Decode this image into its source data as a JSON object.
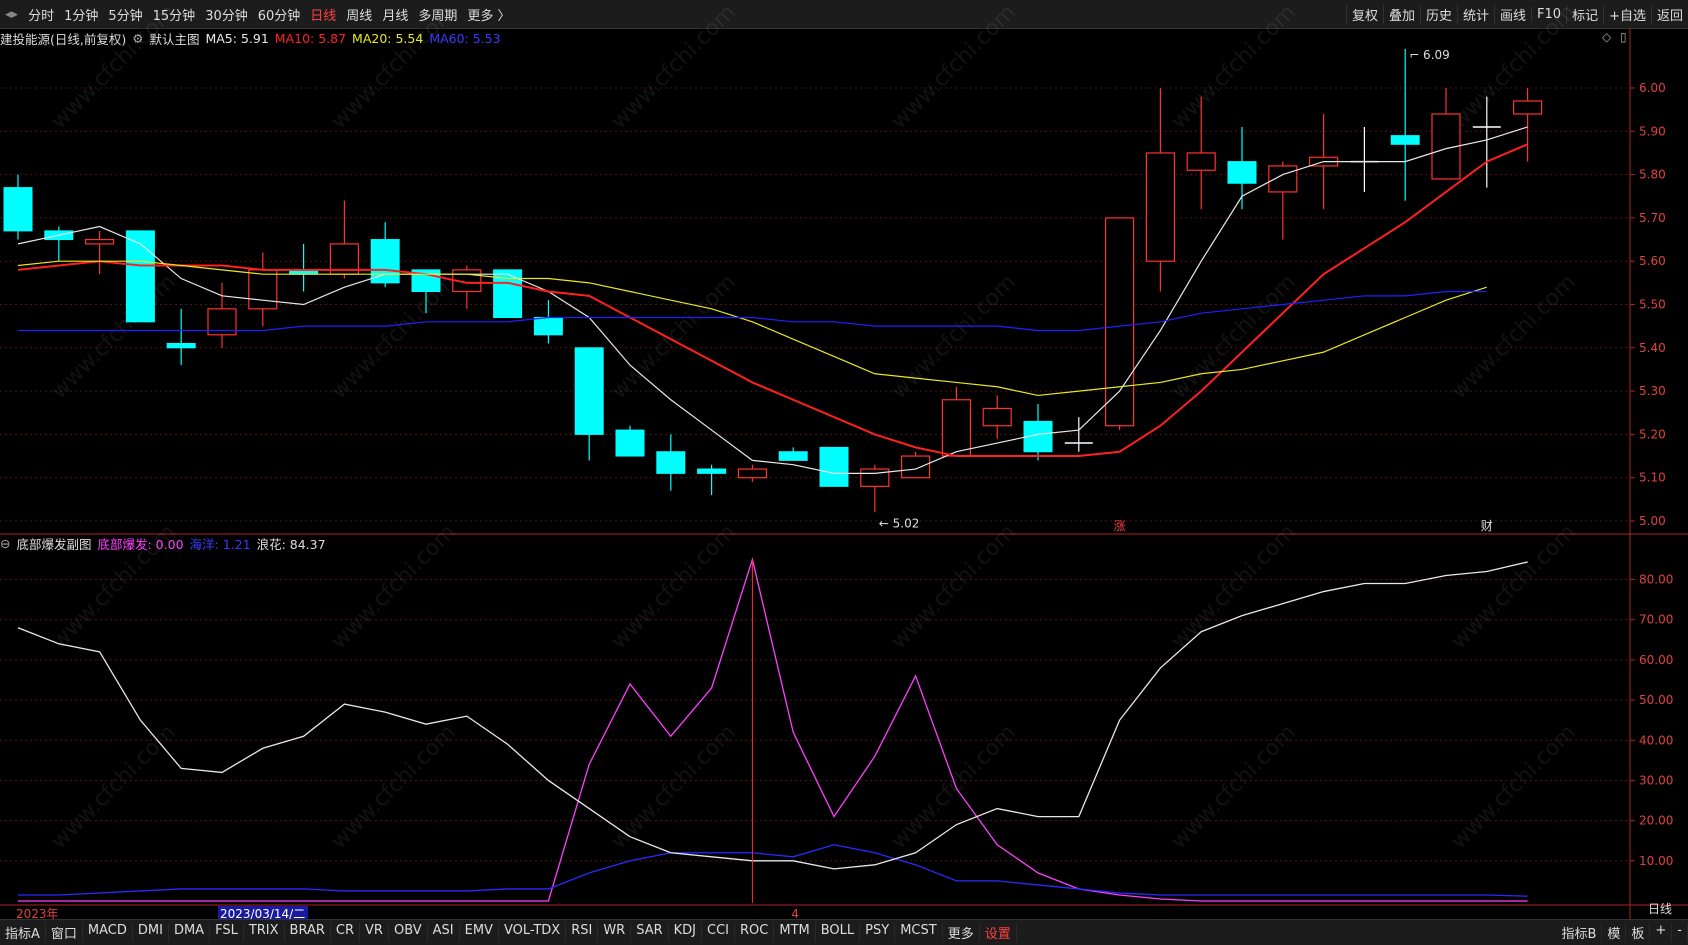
{
  "toolbar": {
    "periods": [
      "分时",
      "1分钟",
      "5分钟",
      "15分钟",
      "30分钟",
      "60分钟",
      "日线",
      "周线",
      "月线",
      "多周期",
      "更多 〉"
    ],
    "active_period": "日线",
    "tools": [
      "复权",
      "叠加",
      "历史",
      "统计",
      "画线",
      "F10",
      "标记",
      "+自选",
      "返回"
    ]
  },
  "main_info": {
    "stock": "建投能源(日线,前复权)",
    "chart_name": "默认主图",
    "ma5": "MA5: 5.91",
    "ma10": "MA10: 5.87",
    "ma20": "MA20: 5.54",
    "ma60": "MA60: 5.53"
  },
  "sub_info": {
    "name": "底部爆发副图",
    "l1": "底部爆发: 0.00",
    "l2": "海洋: 1.21",
    "l3": "浪花: 84.37"
  },
  "bottom_tabs": [
    "指标A",
    "窗口",
    "MACD",
    "DMI",
    "DMA",
    "FSL",
    "TRIX",
    "BRAR",
    "CR",
    "VR",
    "OBV",
    "ASI",
    "EMV",
    "VOL-TDX",
    "RSI",
    "WR",
    "SAR",
    "KDJ",
    "CCI",
    "ROC",
    "MTM",
    "BOLL",
    "PSY",
    "MCST",
    "更多",
    "设置"
  ],
  "bottom_right": [
    "指标B",
    "模",
    "板",
    "+",
    "-"
  ],
  "sub_mode": "日线",
  "colors": {
    "up": "#ff3030",
    "down": "#00ffff",
    "ma5": "#e8e8e8",
    "ma10": "#ff2020",
    "ma20": "#e8e820",
    "ma60": "#2020ff",
    "magenta": "#ff40ff"
  },
  "chart_data": [
    {
      "type": "candlestick",
      "ylim": [
        5.0,
        6.06
      ],
      "yticks": [
        5.0,
        5.1,
        5.2,
        5.3,
        5.4,
        5.5,
        5.6,
        5.7,
        5.8,
        5.9,
        6.0
      ],
      "candles": [
        {
          "o": 5.77,
          "c": 5.67,
          "h": 5.8,
          "l": 5.65
        },
        {
          "o": 5.67,
          "c": 5.65,
          "h": 5.68,
          "l": 5.6
        },
        {
          "o": 5.64,
          "c": 5.65,
          "h": 5.67,
          "l": 5.57
        },
        {
          "o": 5.67,
          "c": 5.46,
          "h": 5.67,
          "l": 5.46
        },
        {
          "o": 5.41,
          "c": 5.4,
          "h": 5.49,
          "l": 5.36
        },
        {
          "o": 5.43,
          "c": 5.49,
          "h": 5.55,
          "l": 5.4
        },
        {
          "o": 5.49,
          "c": 5.58,
          "h": 5.62,
          "l": 5.45
        },
        {
          "o": 5.58,
          "c": 5.57,
          "h": 5.64,
          "l": 5.53
        },
        {
          "o": 5.57,
          "c": 5.64,
          "h": 5.74,
          "l": 5.56
        },
        {
          "o": 5.65,
          "c": 5.55,
          "h": 5.69,
          "l": 5.54
        },
        {
          "o": 5.58,
          "c": 5.53,
          "h": 5.58,
          "l": 5.48
        },
        {
          "o": 5.53,
          "c": 5.58,
          "h": 5.59,
          "l": 5.49
        },
        {
          "o": 5.58,
          "c": 5.47,
          "h": 5.58,
          "l": 5.47
        },
        {
          "o": 5.47,
          "c": 5.43,
          "h": 5.51,
          "l": 5.41
        },
        {
          "o": 5.4,
          "c": 5.2,
          "h": 5.4,
          "l": 5.14
        },
        {
          "o": 5.21,
          "c": 5.15,
          "h": 5.22,
          "l": 5.15
        },
        {
          "o": 5.16,
          "c": 5.11,
          "h": 5.2,
          "l": 5.07
        },
        {
          "o": 5.12,
          "c": 5.11,
          "h": 5.13,
          "l": 5.06
        },
        {
          "o": 5.1,
          "c": 5.12,
          "h": 5.13,
          "l": 5.09
        },
        {
          "o": 5.16,
          "c": 5.14,
          "h": 5.17,
          "l": 5.14
        },
        {
          "o": 5.17,
          "c": 5.08,
          "h": 5.17,
          "l": 5.08
        },
        {
          "o": 5.08,
          "c": 5.12,
          "h": 5.13,
          "l": 5.02
        },
        {
          "o": 5.1,
          "c": 5.15,
          "h": 5.16,
          "l": 5.1
        },
        {
          "o": 5.15,
          "c": 5.28,
          "h": 5.31,
          "l": 5.15
        },
        {
          "o": 5.22,
          "c": 5.26,
          "h": 5.29,
          "l": 5.19
        },
        {
          "o": 5.23,
          "c": 5.16,
          "h": 5.27,
          "l": 5.14
        },
        {
          "o": 5.18,
          "c": 5.18,
          "h": 5.24,
          "l": 5.16
        },
        {
          "o": 5.22,
          "c": 5.7,
          "h": 5.7,
          "l": 5.21
        },
        {
          "o": 5.6,
          "c": 5.85,
          "h": 6.0,
          "l": 5.53
        },
        {
          "o": 5.81,
          "c": 5.85,
          "h": 5.98,
          "l": 5.72
        },
        {
          "o": 5.83,
          "c": 5.78,
          "h": 5.91,
          "l": 5.72
        },
        {
          "o": 5.76,
          "c": 5.82,
          "h": 5.83,
          "l": 5.65
        },
        {
          "o": 5.82,
          "c": 5.84,
          "h": 5.94,
          "l": 5.72
        },
        {
          "o": 5.83,
          "c": 5.83,
          "h": 5.91,
          "l": 5.76
        },
        {
          "o": 5.89,
          "c": 5.87,
          "h": 6.09,
          "l": 5.74
        },
        {
          "o": 5.79,
          "c": 5.94,
          "h": 6.0,
          "l": 5.79
        },
        {
          "o": 5.91,
          "c": 5.91,
          "h": 5.98,
          "l": 5.77
        },
        {
          "o": 5.94,
          "c": 5.97,
          "h": 6.0,
          "l": 5.83
        }
      ],
      "series": [
        {
          "name": "MA5",
          "values": [
            5.64,
            5.66,
            5.68,
            5.64,
            5.56,
            5.52,
            5.51,
            5.5,
            5.54,
            5.57,
            5.57,
            5.57,
            5.57,
            5.53,
            5.47,
            5.36,
            5.28,
            5.21,
            5.14,
            5.13,
            5.11,
            5.11,
            5.12,
            5.16,
            5.18,
            5.2,
            5.21,
            5.3,
            5.44,
            5.6,
            5.75,
            5.8,
            5.83,
            5.83,
            5.83,
            5.86,
            5.88,
            5.91
          ]
        },
        {
          "name": "MA10",
          "values": [
            5.58,
            5.59,
            5.6,
            5.59,
            5.59,
            5.59,
            5.58,
            5.58,
            5.58,
            5.58,
            5.57,
            5.55,
            5.55,
            5.53,
            5.52,
            5.47,
            5.42,
            5.37,
            5.32,
            5.28,
            5.24,
            5.2,
            5.17,
            5.15,
            5.15,
            5.15,
            5.15,
            5.16,
            5.22,
            5.3,
            5.39,
            5.48,
            5.57,
            5.63,
            5.69,
            5.76,
            5.83,
            5.87
          ]
        },
        {
          "name": "MA20",
          "values": [
            5.59,
            5.6,
            5.6,
            5.6,
            5.59,
            5.58,
            5.57,
            5.57,
            5.57,
            5.57,
            5.57,
            5.57,
            5.56,
            5.56,
            5.55,
            5.53,
            5.51,
            5.49,
            5.46,
            5.42,
            5.38,
            5.34,
            5.33,
            5.32,
            5.31,
            5.29,
            5.3,
            5.31,
            5.32,
            5.34,
            5.35,
            5.37,
            5.39,
            5.43,
            5.47,
            5.51,
            5.54
          ]
        },
        {
          "name": "MA60",
          "values": [
            5.44,
            5.44,
            5.44,
            5.44,
            5.44,
            5.44,
            5.44,
            5.45,
            5.45,
            5.45,
            5.46,
            5.46,
            5.46,
            5.47,
            5.47,
            5.47,
            5.47,
            5.47,
            5.47,
            5.46,
            5.46,
            5.45,
            5.45,
            5.45,
            5.45,
            5.44,
            5.44,
            5.45,
            5.46,
            5.48,
            5.49,
            5.5,
            5.51,
            5.52,
            5.52,
            5.53,
            5.53
          ]
        }
      ],
      "annotations": [
        {
          "text": "6.09",
          "index": 34,
          "value": 6.09
        },
        {
          "text": "5.02",
          "index": 21,
          "value": 5.02
        }
      ],
      "markers": [
        {
          "text": "涨",
          "index": 27
        },
        {
          "text": "财",
          "index": 36
        }
      ]
    },
    {
      "type": "line",
      "ylim": [
        0,
        88
      ],
      "yticks": [
        10,
        20,
        30,
        40,
        50,
        60,
        70,
        80
      ],
      "yticklabels": [
        "10.00",
        "20.00",
        "30.00",
        "40.00",
        "50.00",
        "60.00",
        "70.00",
        "80.00"
      ],
      "series": [
        {
          "name": "底部爆发",
          "values": [
            0,
            0,
            0,
            0,
            0,
            0,
            0,
            0,
            0,
            0,
            0,
            0,
            0,
            0,
            34,
            54,
            41,
            53,
            85,
            42,
            21,
            36,
            56,
            28,
            14,
            7,
            3,
            1.5,
            0.5,
            0,
            0,
            0,
            0,
            0,
            0,
            0,
            0,
            0
          ]
        },
        {
          "name": "海洋",
          "values": [
            1.5,
            1.5,
            2,
            2.5,
            3,
            3,
            3,
            3,
            2.5,
            2.5,
            2.5,
            2.5,
            3,
            3,
            7,
            10,
            12,
            12,
            12,
            11,
            14,
            12,
            9,
            5,
            5,
            4,
            3,
            2,
            1.5,
            1.5,
            1.5,
            1.5,
            1.5,
            1.5,
            1.5,
            1.5,
            1.5,
            1.2
          ]
        },
        {
          "name": "浪花",
          "values": [
            68,
            64,
            62,
            45,
            33,
            32,
            38,
            41,
            49,
            47,
            44,
            46,
            39,
            30,
            23,
            16,
            12,
            11,
            10,
            10,
            8,
            9,
            12,
            19,
            23,
            21,
            21,
            45,
            58,
            67,
            71,
            74,
            77,
            79,
            79,
            81,
            82,
            84.37
          ]
        }
      ],
      "vline_index": 18,
      "xlabels": [
        {
          "text": "2023年",
          "index": 0
        },
        {
          "text": "2023/03/14/二",
          "index": 5
        },
        {
          "text": "4",
          "index": 19
        }
      ]
    }
  ]
}
